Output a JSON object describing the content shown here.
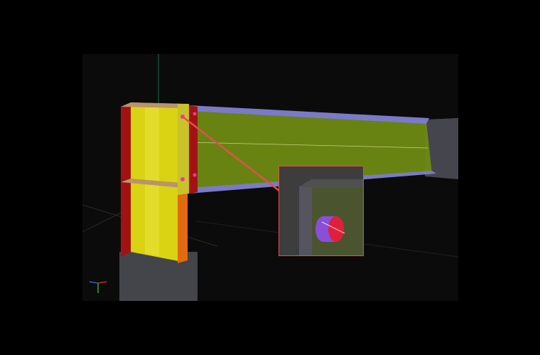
{
  "viewer": {
    "background": "#0b0b0b",
    "frame_background": "#000000"
  },
  "colors": {
    "column_flange": "#a31212",
    "column_web": "#d9d314",
    "stiffener": "#e26a10",
    "beam_web": "#6e8a12",
    "beam_flange": "#7a7ac8",
    "steel_ghost": "#4a4a52",
    "highlight": "#e0524a",
    "bolt_shank": "#8a4fd8",
    "bolt_head": "#e0203a"
  },
  "icons": {
    "axis": "axis-triad-icon",
    "bolt": "bolt-icon",
    "callout_arrow": "arrow-icon"
  }
}
